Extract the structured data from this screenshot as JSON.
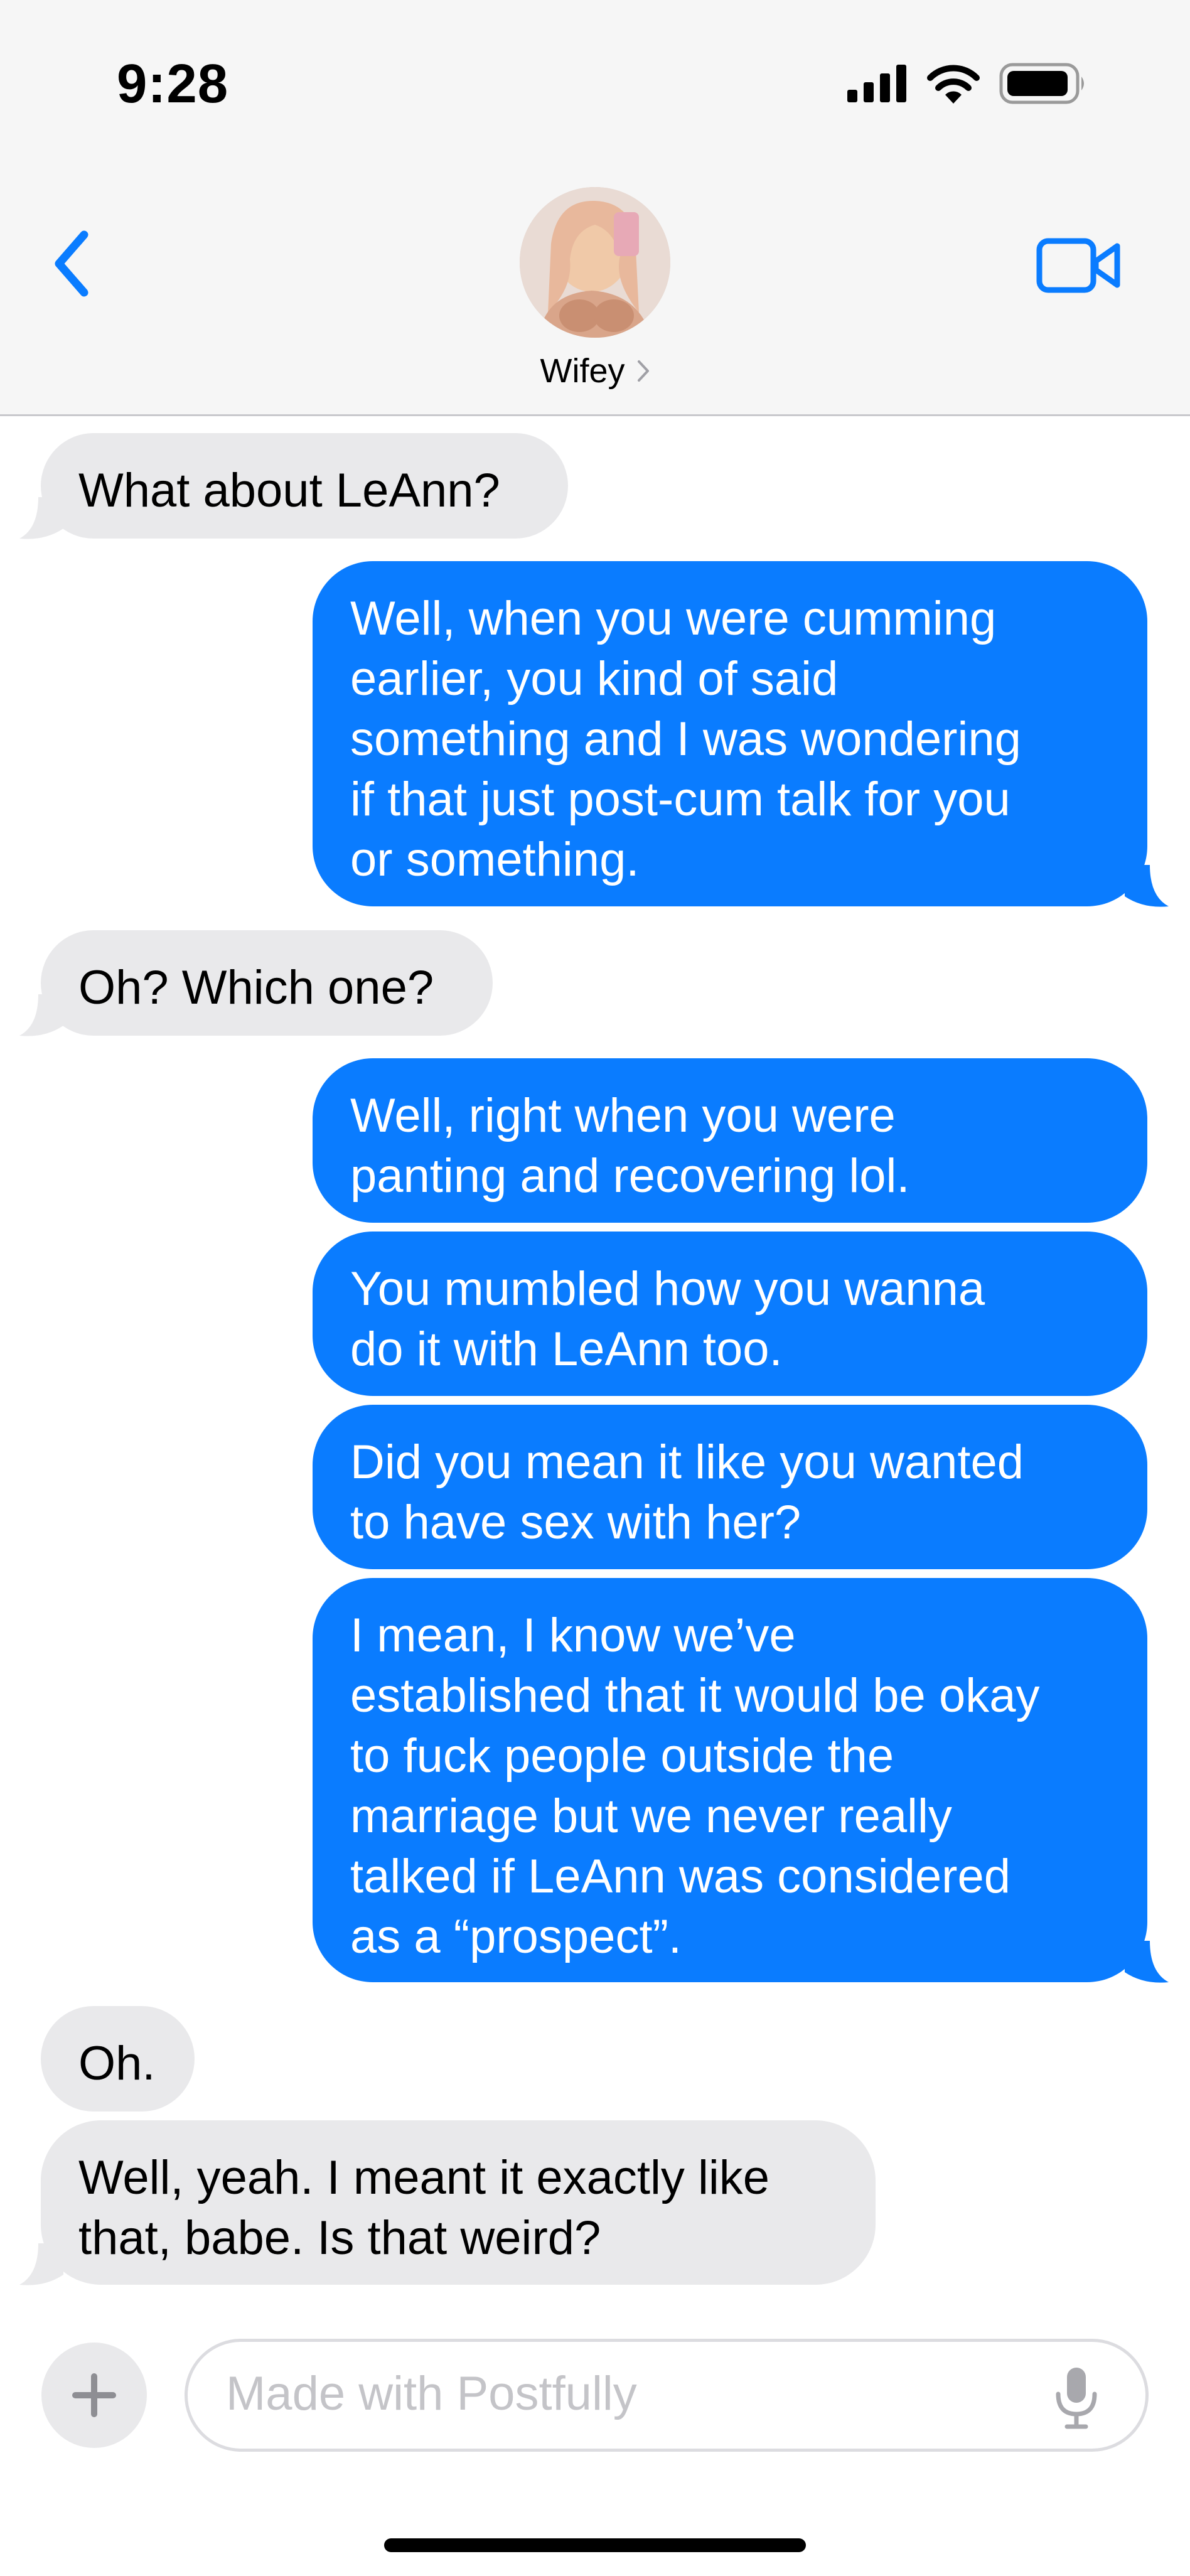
{
  "status_bar": {
    "time": "9:28"
  },
  "header": {
    "contact_name": "Wifey"
  },
  "messages": [
    {
      "side": "in",
      "lines": [
        "What about LeAnn?"
      ]
    },
    {
      "side": "out",
      "lines": [
        "Well, when you were cumming",
        "earlier, you kind of said",
        "something and I was wondering",
        "if that just post-cum talk for you",
        "or something."
      ]
    },
    {
      "side": "in",
      "lines": [
        "Oh? Which one?"
      ]
    },
    {
      "side": "out",
      "lines": [
        "Well, right when you were",
        "panting and recovering lol."
      ]
    },
    {
      "side": "out",
      "lines": [
        "You mumbled how you wanna",
        "do it with LeAnn too."
      ]
    },
    {
      "side": "out",
      "lines": [
        "Did you mean it like you wanted",
        "to have sex with her?"
      ]
    },
    {
      "side": "out",
      "lines": [
        "I mean, I know we’ve",
        "established that it would be okay",
        "to fuck people outside the",
        "marriage but we never really",
        "talked if LeAnn was considered",
        "as a “prospect”."
      ]
    },
    {
      "side": "in",
      "lines": [
        "Oh."
      ]
    },
    {
      "side": "in",
      "lines": [
        "Well, yeah. I meant it exactly like",
        "that, babe. Is that weird?"
      ]
    }
  ],
  "composer": {
    "placeholder": "Made with Postfully"
  },
  "colors": {
    "outgoing": "#0a7cff",
    "incoming": "#e9e9eb",
    "accent": "#0a7cff"
  },
  "icons": [
    "back-chevron-icon",
    "video-camera-icon",
    "plus-icon",
    "microphone-icon",
    "signal-icon",
    "wifi-icon",
    "battery-icon"
  ]
}
